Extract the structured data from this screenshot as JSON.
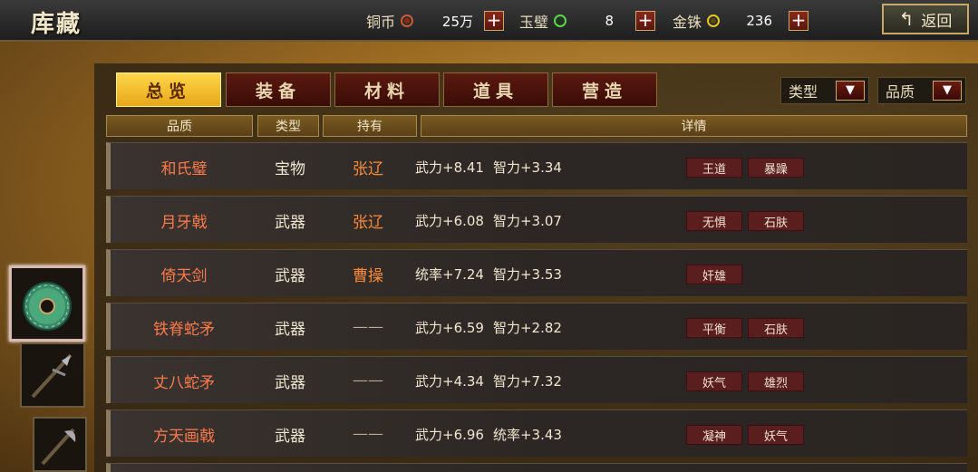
{
  "header": {
    "title": "库藏",
    "back_label": "返回",
    "resources": [
      {
        "label": "铜币",
        "value": "25万",
        "icon": "copper-coin-icon",
        "color": "#c85a3a"
      },
      {
        "label": "玉璧",
        "value": "8",
        "icon": "jade-icon",
        "color": "#5ad84a"
      },
      {
        "label": "金铢",
        "value": "236",
        "icon": "gold-icon",
        "color": "#e8c820"
      }
    ]
  },
  "tabs": [
    {
      "label": "总览",
      "active": true
    },
    {
      "label": "装备",
      "active": false
    },
    {
      "label": "材料",
      "active": false
    },
    {
      "label": "道具",
      "active": false
    },
    {
      "label": "营造",
      "active": false
    }
  ],
  "filters": [
    {
      "label": "类型"
    },
    {
      "label": "品质"
    }
  ],
  "columns": [
    "品质",
    "类型",
    "持有",
    "详情"
  ],
  "rows": [
    {
      "name": "和氏璧",
      "type": "宝物",
      "holder": "张辽",
      "stat1": "武力+8.41",
      "stat2": "智力+3.34",
      "tags": [
        "王道",
        "暴躁"
      ]
    },
    {
      "name": "月牙戟",
      "type": "武器",
      "holder": "张辽",
      "stat1": "武力+6.08",
      "stat2": "智力+3.07",
      "tags": [
        "无惧",
        "石肤"
      ]
    },
    {
      "name": "倚天剑",
      "type": "武器",
      "holder": "曹操",
      "stat1": "统率+7.24",
      "stat2": "智力+3.53",
      "tags": [
        "奸雄"
      ]
    },
    {
      "name": "铁脊蛇矛",
      "type": "武器",
      "holder": "——",
      "stat1": "武力+6.59",
      "stat2": "智力+2.82",
      "tags": [
        "平衡",
        "石肤"
      ]
    },
    {
      "name": "丈八蛇矛",
      "type": "武器",
      "holder": "——",
      "stat1": "武力+4.34",
      "stat2": "智力+7.32",
      "tags": [
        "妖气",
        "雄烈"
      ]
    },
    {
      "name": "方天画戟",
      "type": "武器",
      "holder": "——",
      "stat1": "武力+6.96",
      "stat2": "统率+3.43",
      "tags": [
        "凝神",
        "妖气"
      ]
    }
  ],
  "side_items": [
    {
      "icon": "jade-bi-icon",
      "selected": true
    },
    {
      "icon": "spear-icon",
      "selected": false
    },
    {
      "icon": "halberd-icon",
      "selected": false
    }
  ]
}
